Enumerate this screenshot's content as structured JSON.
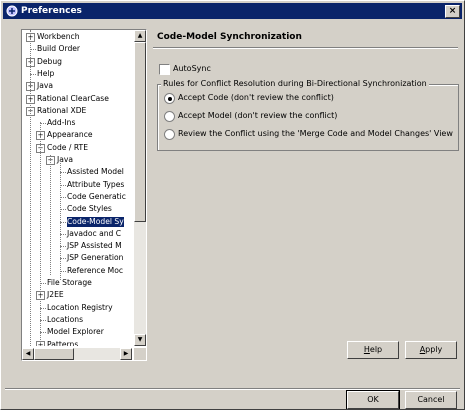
{
  "window": {
    "title": "Preferences",
    "close_glyph": "×"
  },
  "tree": {
    "expand_plus": "+",
    "expand_minus": "−",
    "items": [
      {
        "label": "Workbench",
        "expander": "plus"
      },
      {
        "label": "Build Order"
      },
      {
        "label": "Debug",
        "expander": "plus"
      },
      {
        "label": "Help"
      },
      {
        "label": "Java",
        "expander": "plus"
      },
      {
        "label": "Rational ClearCase",
        "expander": "plus"
      },
      {
        "label": "Rational XDE",
        "expander": "minus"
      },
      {
        "label": "Add-Ins"
      },
      {
        "label": "Appearance",
        "expander": "plus"
      },
      {
        "label": "Code / RTE",
        "expander": "minus"
      },
      {
        "label": "Java",
        "expander": "minus"
      },
      {
        "label": "Assisted Model"
      },
      {
        "label": "Attribute Types"
      },
      {
        "label": "Code Generatic"
      },
      {
        "label": "Code Styles"
      },
      {
        "label": "Code-Model Sy",
        "selected": true
      },
      {
        "label": "Javadoc and C"
      },
      {
        "label": "JSP Assisted M"
      },
      {
        "label": "JSP Generation"
      },
      {
        "label": "Reference Moc"
      },
      {
        "label": "File Storage"
      },
      {
        "label": "J2EE",
        "expander": "plus"
      },
      {
        "label": "Location Registry"
      },
      {
        "label": "Locations"
      },
      {
        "label": "Model Explorer"
      },
      {
        "label": "Patterns",
        "expander": "plus"
      }
    ],
    "scroll_up": "▲",
    "scroll_down": "▼",
    "scroll_left": "◀",
    "scroll_right": "▶"
  },
  "page": {
    "title": "Code-Model Synchronization",
    "autosync_label": "AutoSync",
    "autosync_checked": false,
    "group_label": "Rules for Conflict Resolution during Bi-Directional Synchronization",
    "options": [
      {
        "label": "Accept Code (don't review the conflict)",
        "checked": true
      },
      {
        "label": "Accept Model (don't review the conflict)",
        "checked": false
      },
      {
        "label": "Review the Conflict using the 'Merge Code and Model Changes' View",
        "checked": false
      }
    ]
  },
  "buttons": {
    "help_mnemonic": "H",
    "help_rest": "elp",
    "apply_mnemonic": "A",
    "apply_rest": "pply",
    "ok": "OK",
    "cancel": "Cancel"
  },
  "colors": {
    "titlebar": "#0a246a",
    "dialog_bg": "#d4d0c8",
    "selection": "#0a246a"
  }
}
